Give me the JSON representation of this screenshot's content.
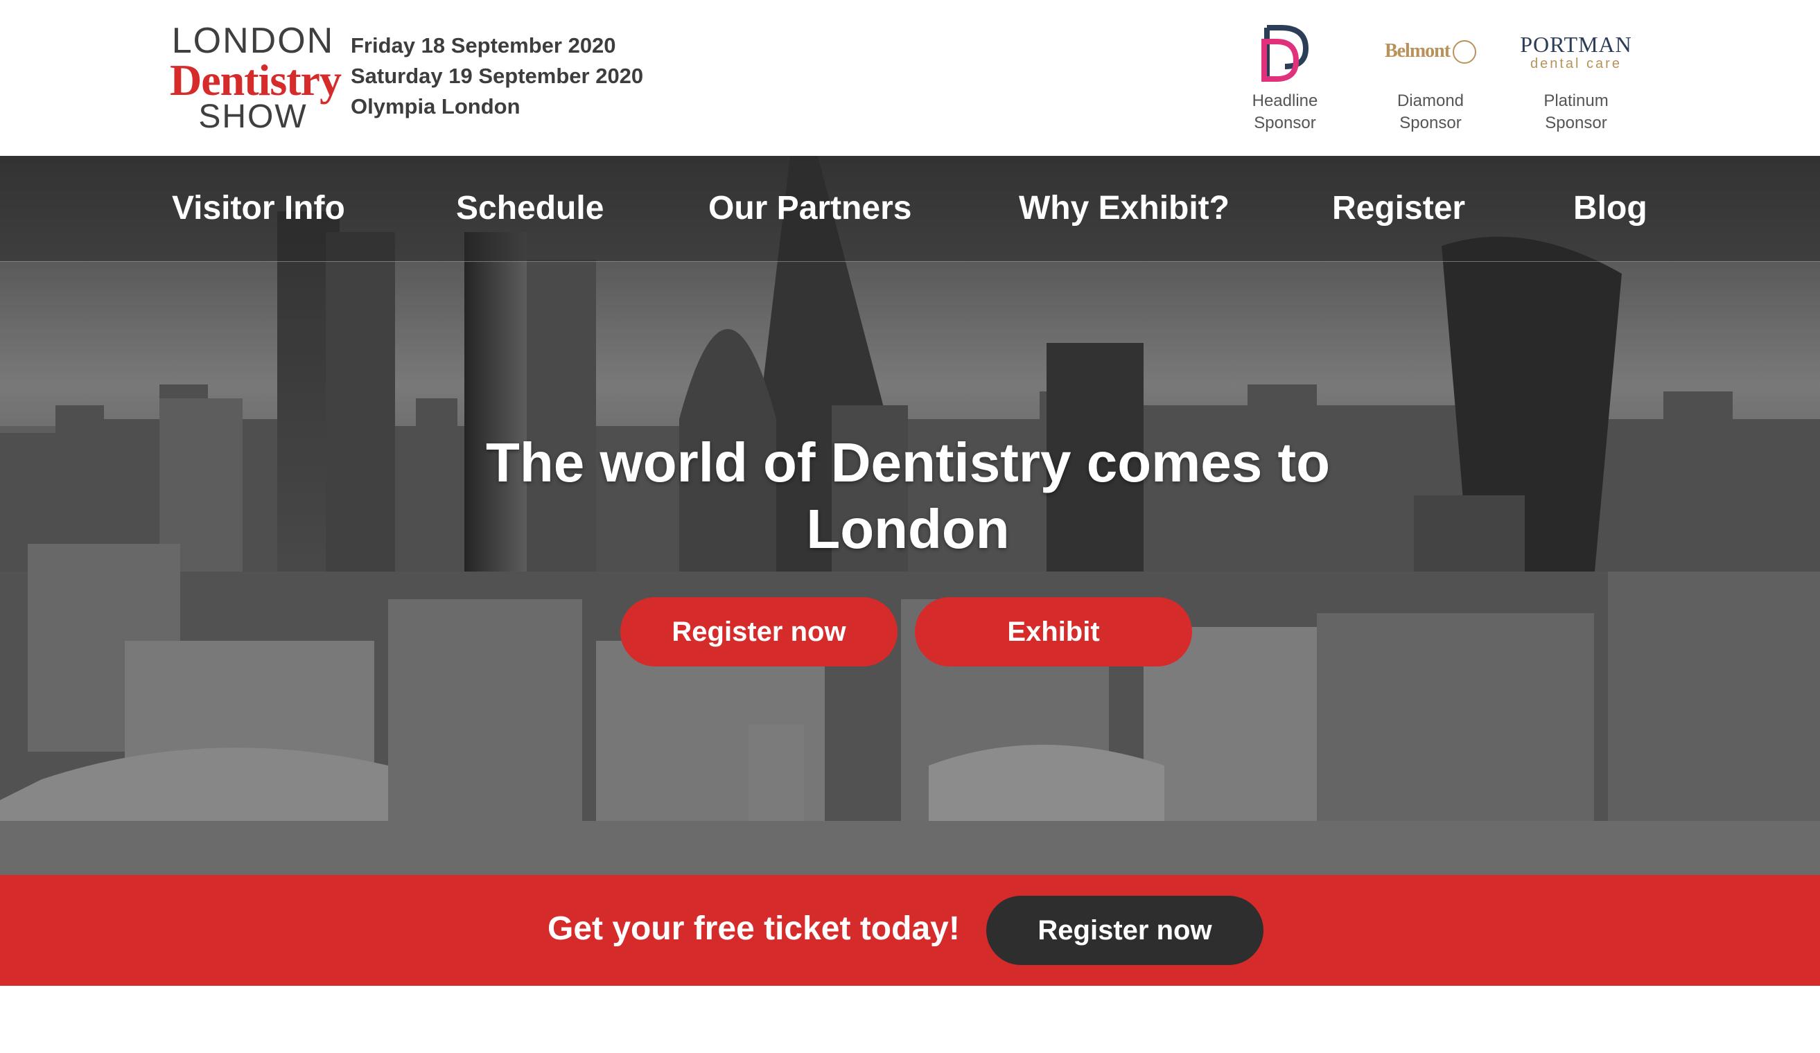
{
  "logo": {
    "line1": "LONDON",
    "line2": "Dentistry",
    "line3": "SHOW"
  },
  "event": {
    "date1": "Friday 18 September 2020",
    "date2": "Saturday 19 September 2020",
    "venue": "Olympia London"
  },
  "sponsors": [
    {
      "caption_line1": "Headline",
      "caption_line2": "Sponsor",
      "icon": "dd-logo-icon"
    },
    {
      "caption_line1": "Diamond",
      "caption_line2": "Sponsor",
      "logo_text": "Belmont",
      "icon": "belmont-logo-icon"
    },
    {
      "caption_line1": "Platinum",
      "caption_line2": "Sponsor",
      "logo_text_1": "PORTMAN",
      "logo_text_2": "dental care",
      "icon": "portman-logo-icon"
    }
  ],
  "nav": {
    "items": [
      "Visitor Info",
      "Schedule",
      "Our Partners",
      "Why Exhibit?",
      "Register",
      "Blog"
    ]
  },
  "hero": {
    "title": "The world of Dentistry comes to London",
    "register_button": "Register now",
    "exhibit_button": "Exhibit"
  },
  "cta": {
    "text": "Get your free ticket today!",
    "button": "Register now"
  },
  "colors": {
    "accent_red": "#d62b2b",
    "dark_button": "#2e2e2e",
    "gold": "#b8925a",
    "navy": "#2c3e57"
  }
}
